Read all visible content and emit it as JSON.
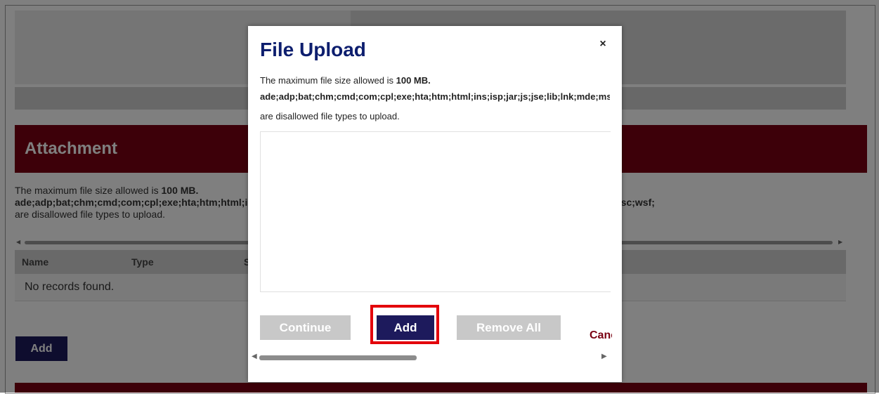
{
  "background": {
    "attachment_heading": "Attachment",
    "max_size_prefix": "The maximum file size allowed is ",
    "max_size_value": "100 MB.",
    "disallowed_list": "ade;adp;bat;chm;cmd;com;cpl;exe;hta;htm;html;ins;isp;jar;js;jse;lib;lnk;mde;msc;msp;mst;pif;scr;sct;shb;sys;vb;vbe;vbs;vxd;wsc;wsf;",
    "disallowed_suffix": "are disallowed file types to upload.",
    "table_headers": [
      "Name",
      "Type",
      "Size"
    ],
    "empty_text": "No records found.",
    "add_label": "Add",
    "accent_color": "#7a0012",
    "button_color": "#1d1a5c"
  },
  "modal": {
    "title": "File Upload",
    "close_glyph": "×",
    "max_size_prefix": "The maximum file size allowed is ",
    "max_size_value": "100 MB.",
    "disallowed_list": "ade;adp;bat;chm;cmd;com;cpl;exe;hta;htm;html;ins;isp;jar;js;jse;lib;lnk;mde;msc;msp;mst;pif;scr;sct;shb;sys;vb;vbe;vbs;vxd;wsc;wsf;",
    "disallowed_suffix": "are disallowed file types to upload.",
    "continue_label": "Continue",
    "add_label": "Add",
    "remove_all_label": "Remove All",
    "cancel_label": "Cancel",
    "highlight_color": "#e3000b"
  }
}
